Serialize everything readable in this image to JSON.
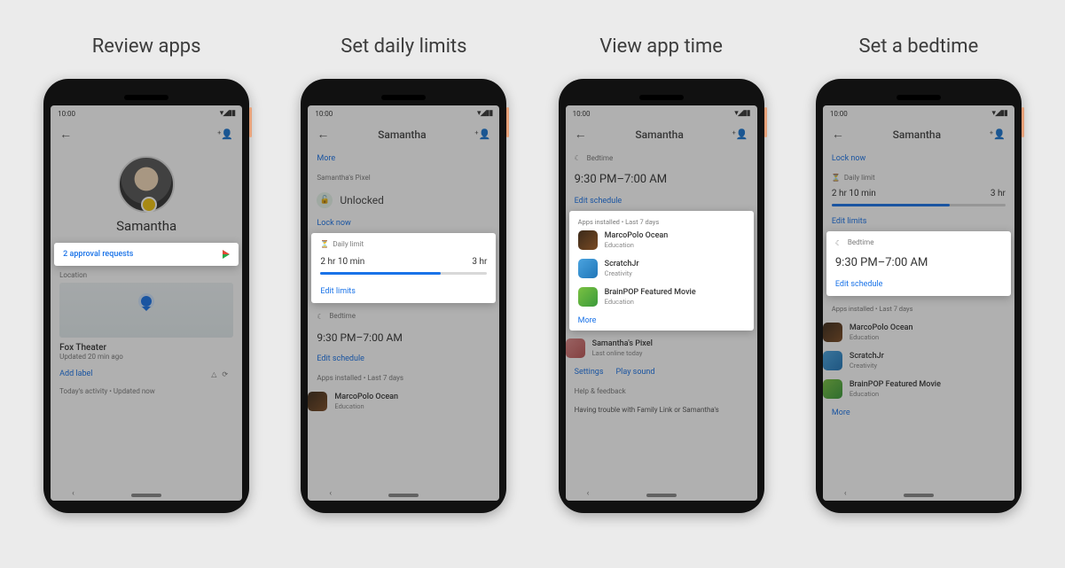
{
  "captions": [
    "Review apps",
    "Set daily limits",
    "View app time",
    "Set a bedtime"
  ],
  "status": {
    "time": "10:00",
    "signal": "▾◢▮▮"
  },
  "child": {
    "name": "Samantha"
  },
  "phone1": {
    "approval": "2 approval requests",
    "location_label": "Location",
    "place": "Fox Theater",
    "updated": "Updated 20 min ago",
    "add_label": "Add label",
    "activity": "Today's activity • Updated now"
  },
  "phone2": {
    "more": "More",
    "device_label": "Samantha's Pixel",
    "unlocked": "Unlocked",
    "lock_now": "Lock now",
    "daily_limit_label": "Daily limit",
    "used": "2 hr 10 min",
    "total": "3 hr",
    "edit_limits": "Edit limits",
    "bedtime_label": "Bedtime",
    "bedtime_range": "9:30 PM–7:00 AM",
    "edit_schedule": "Edit schedule",
    "apps_installed": "Apps installed • Last 7 days",
    "app1_name": "MarcoPolo Ocean",
    "app1_cat": "Education"
  },
  "phone3": {
    "bedtime_label": "Bedtime",
    "bedtime_range": "9:30 PM–7:00 AM",
    "edit_schedule": "Edit schedule",
    "apps_installed": "Apps installed • Last 7 days",
    "app1_name": "MarcoPolo Ocean",
    "app1_cat": "Education",
    "app2_name": "ScratchJr",
    "app2_cat": "Creativity",
    "app3_name": "BrainPOP Featured Movie",
    "app3_cat": "Education",
    "more": "More",
    "pixel_name": "Samantha's Pixel",
    "pixel_sub": "Last online today",
    "settings": "Settings",
    "play_sound": "Play sound",
    "help": "Help & feedback",
    "trouble": "Having trouble with Family Link or Samantha's"
  },
  "phone4": {
    "lock_now": "Lock now",
    "daily_limit_label": "Daily limit",
    "used": "2 hr 10 min",
    "total": "3 hr",
    "edit_limits": "Edit limits",
    "bedtime_label": "Bedtime",
    "bedtime_range": "9:30 PM–7:00 AM",
    "edit_schedule": "Edit schedule",
    "apps_installed": "Apps installed • Last 7 days",
    "app1_name": "MarcoPolo Ocean",
    "app1_cat": "Education",
    "app2_name": "ScratchJr",
    "app2_cat": "Creativity",
    "app3_name": "BrainPOP Featured Movie",
    "app3_cat": "Education",
    "more": "More"
  }
}
